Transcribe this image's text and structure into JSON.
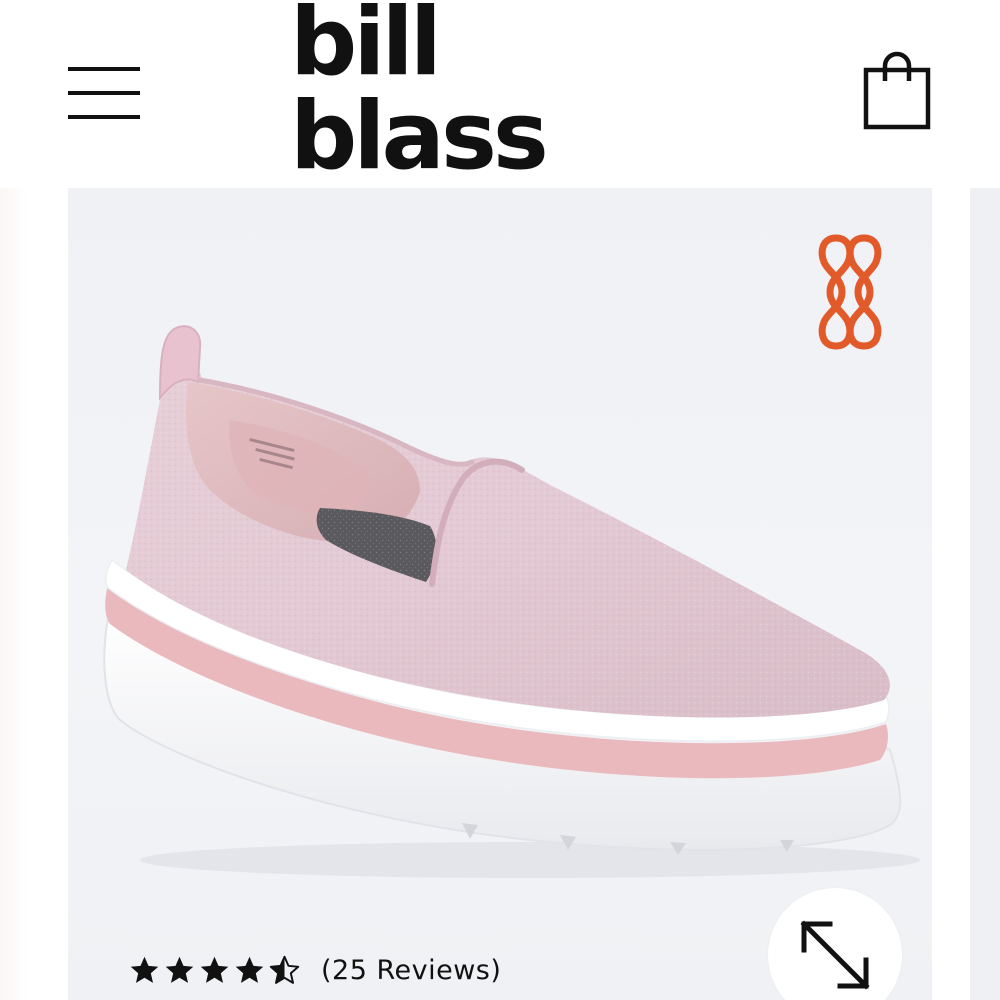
{
  "header": {
    "brand": "bill blass",
    "menu_icon": "hamburger-menu-icon",
    "cart_icon": "shopping-bag-icon"
  },
  "product": {
    "image_description_icon": "pink-knit-slip-on-sneaker",
    "brand_badge_icon": "bb-monogram-icon",
    "brand_color": "#e2592a"
  },
  "rating": {
    "value": 4.5,
    "max": 5,
    "review_count_label": "(25 Reviews)"
  },
  "zoom": {
    "icon": "expand-arrow-icon"
  }
}
